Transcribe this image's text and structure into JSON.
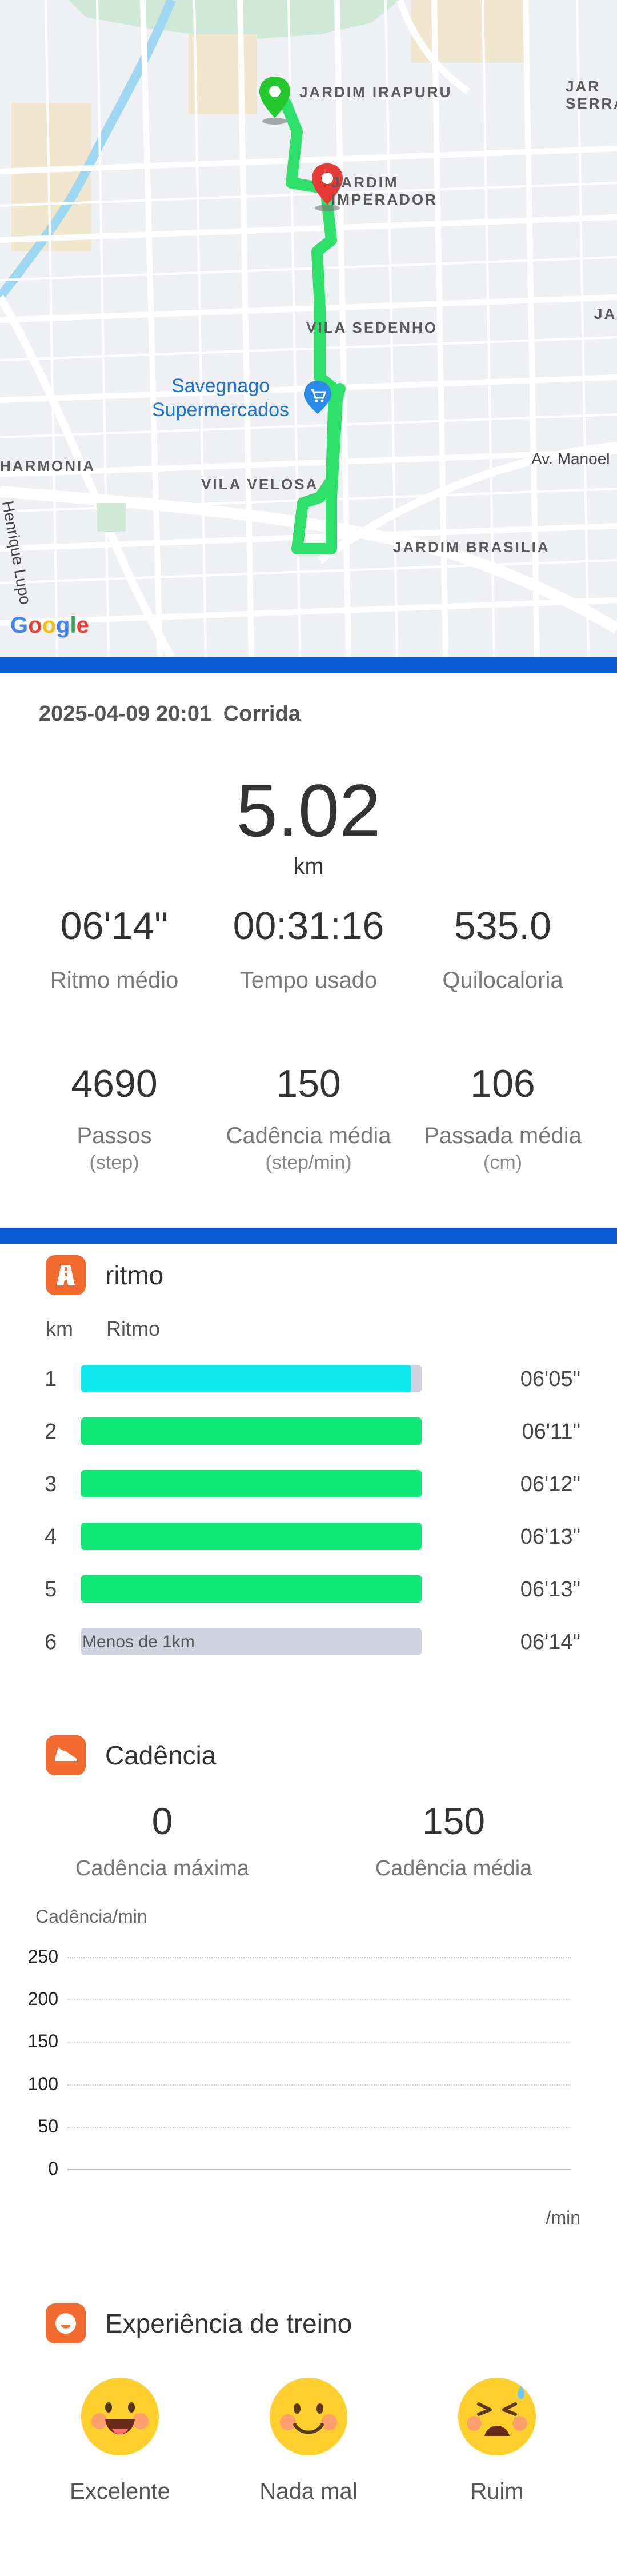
{
  "map": {
    "labels": {
      "jardim_irapuru": "JARDIM IRAPURU",
      "jardim_imperador": "JARDIM IMPERADOR",
      "jardim_serra": "JAR SERRA",
      "vila_sedenho": "VILA SEDENHO",
      "vila_velosa": "VILA VELOSA",
      "jardim_brasilia": "JARDIM BRASILIA",
      "harmonia": "HARMONIA",
      "ja": "JA",
      "av_manoel": "Av. Manoel",
      "henrique_lupo": "Henrique Lupo"
    },
    "poi": "Savegnago Supermercados",
    "google_logo": "Google",
    "colors": {
      "route": "#2ee06a",
      "start_pin": "#22c82e",
      "end_pin": "#e53935"
    }
  },
  "summary": {
    "datetime": "2025-04-09 20:01",
    "activity": "Corrida",
    "distance": "5.02",
    "distance_unit": "km",
    "stats_row1": [
      {
        "value": "06'14\"",
        "label": "Ritmo médio"
      },
      {
        "value": "00:31:16",
        "label": "Tempo usado"
      },
      {
        "value": "535.0",
        "label": "Quilocaloria"
      }
    ],
    "stats_row2": [
      {
        "value": "4690",
        "label": "Passos",
        "unit": "(step)"
      },
      {
        "value": "150",
        "label": "Cadência média",
        "unit": "(step/min)"
      },
      {
        "value": "106",
        "label": "Passada média",
        "unit": "(cm)"
      }
    ]
  },
  "pace": {
    "title": "ritmo",
    "col_km": "km",
    "col_pace": "Ritmo",
    "rows": [
      {
        "km": "1",
        "value": "06'05\"",
        "fill": 0.97,
        "color": "#10e8f0"
      },
      {
        "km": "2",
        "value": "06'11\"",
        "fill": 1.0,
        "color": "#10e878"
      },
      {
        "km": "3",
        "value": "06'12\"",
        "fill": 1.0,
        "color": "#10e878"
      },
      {
        "km": "4",
        "value": "06'13\"",
        "fill": 1.0,
        "color": "#10e878"
      },
      {
        "km": "5",
        "value": "06'13\"",
        "fill": 1.0,
        "color": "#10e878"
      },
      {
        "km": "6",
        "value": "06'14\"",
        "fill": 0.0,
        "color": "#d2d3e0",
        "note": "Menos de 1km"
      }
    ]
  },
  "cadence": {
    "title": "Cadência",
    "max_value": "0",
    "max_label": "Cadência máxima",
    "avg_value": "150",
    "avg_label": "Cadência média"
  },
  "chart_data": {
    "type": "line",
    "ylabel": "Cadência/min",
    "xlabel": "/min",
    "ylim": [
      0,
      250
    ],
    "yticks": [
      "250",
      "200",
      "150",
      "100",
      "50",
      "0"
    ],
    "grid": true,
    "series": []
  },
  "experience": {
    "title": "Experiência de treino",
    "options": [
      {
        "label": "Excelente",
        "icon": "excellent-face-icon"
      },
      {
        "label": "Nada mal",
        "icon": "smile-face-icon"
      },
      {
        "label": "Ruim",
        "icon": "tired-face-icon"
      }
    ]
  }
}
